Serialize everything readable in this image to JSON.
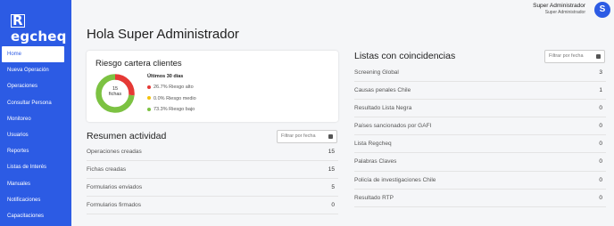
{
  "brand": {
    "logo_box": "R",
    "logo_rest": "egcheq"
  },
  "sidebar": {
    "items": [
      {
        "label": "Home",
        "active": true
      },
      {
        "label": "Nueva Operación"
      },
      {
        "label": "Operaciones"
      },
      {
        "label": "Consultar Persona"
      },
      {
        "label": "Monitoreo"
      },
      {
        "label": "Usuarios"
      },
      {
        "label": "Reportes"
      },
      {
        "label": "Listas de Interés"
      },
      {
        "label": "Manuales"
      },
      {
        "label": "Notificaciones"
      },
      {
        "label": "Capacitaciones"
      }
    ]
  },
  "header": {
    "user_name": "Super Administrador",
    "user_role": "Super Administrador",
    "avatar_initial": "S"
  },
  "greeting": "Hola Super Administrador",
  "risk": {
    "title": "Riesgo cartera clientes",
    "center_count": "15",
    "center_unit": "fichas",
    "period": "Últimos 30 días",
    "legend": [
      {
        "label": "26.7% Riesgo alto",
        "color": "#e53935"
      },
      {
        "label": "0.0% Riesgo medio",
        "color": "#f4c20d"
      },
      {
        "label": "73.3% Riesgo bajo",
        "color": "#7cc242"
      }
    ],
    "chart_data": {
      "type": "pie",
      "categories": [
        "Riesgo alto",
        "Riesgo medio",
        "Riesgo bajo"
      ],
      "values": [
        26.7,
        0.0,
        73.3
      ],
      "colors": [
        "#e53935",
        "#f4c20d",
        "#7cc242"
      ],
      "title": "",
      "xlabel": "",
      "ylabel": ""
    }
  },
  "activity": {
    "title": "Resumen actividad",
    "filter_placeholder": "Filtrar por fecha",
    "rows": [
      {
        "label": "Operaciones creadas",
        "value": "15"
      },
      {
        "label": "Fichas creadas",
        "value": "15"
      },
      {
        "label": "Formularios enviados",
        "value": "5"
      },
      {
        "label": "Formularios firmados",
        "value": "0"
      }
    ]
  },
  "lists": {
    "title": "Listas con coincidencias",
    "filter_placeholder": "Filtrar por fecha",
    "rows": [
      {
        "label": "Screening Global",
        "value": "3"
      },
      {
        "label": "Causas penales Chile",
        "value": "1"
      },
      {
        "label": "Resultado Lista Negra",
        "value": "0"
      },
      {
        "label": "Países sancionados por GAFI",
        "value": "0"
      },
      {
        "label": "Lista Regcheq",
        "value": "0"
      },
      {
        "label": "Palabras Claves",
        "value": "0"
      },
      {
        "label": "Policía de investigaciones Chile",
        "value": "0"
      },
      {
        "label": "Resultado RTP",
        "value": "0"
      }
    ]
  }
}
